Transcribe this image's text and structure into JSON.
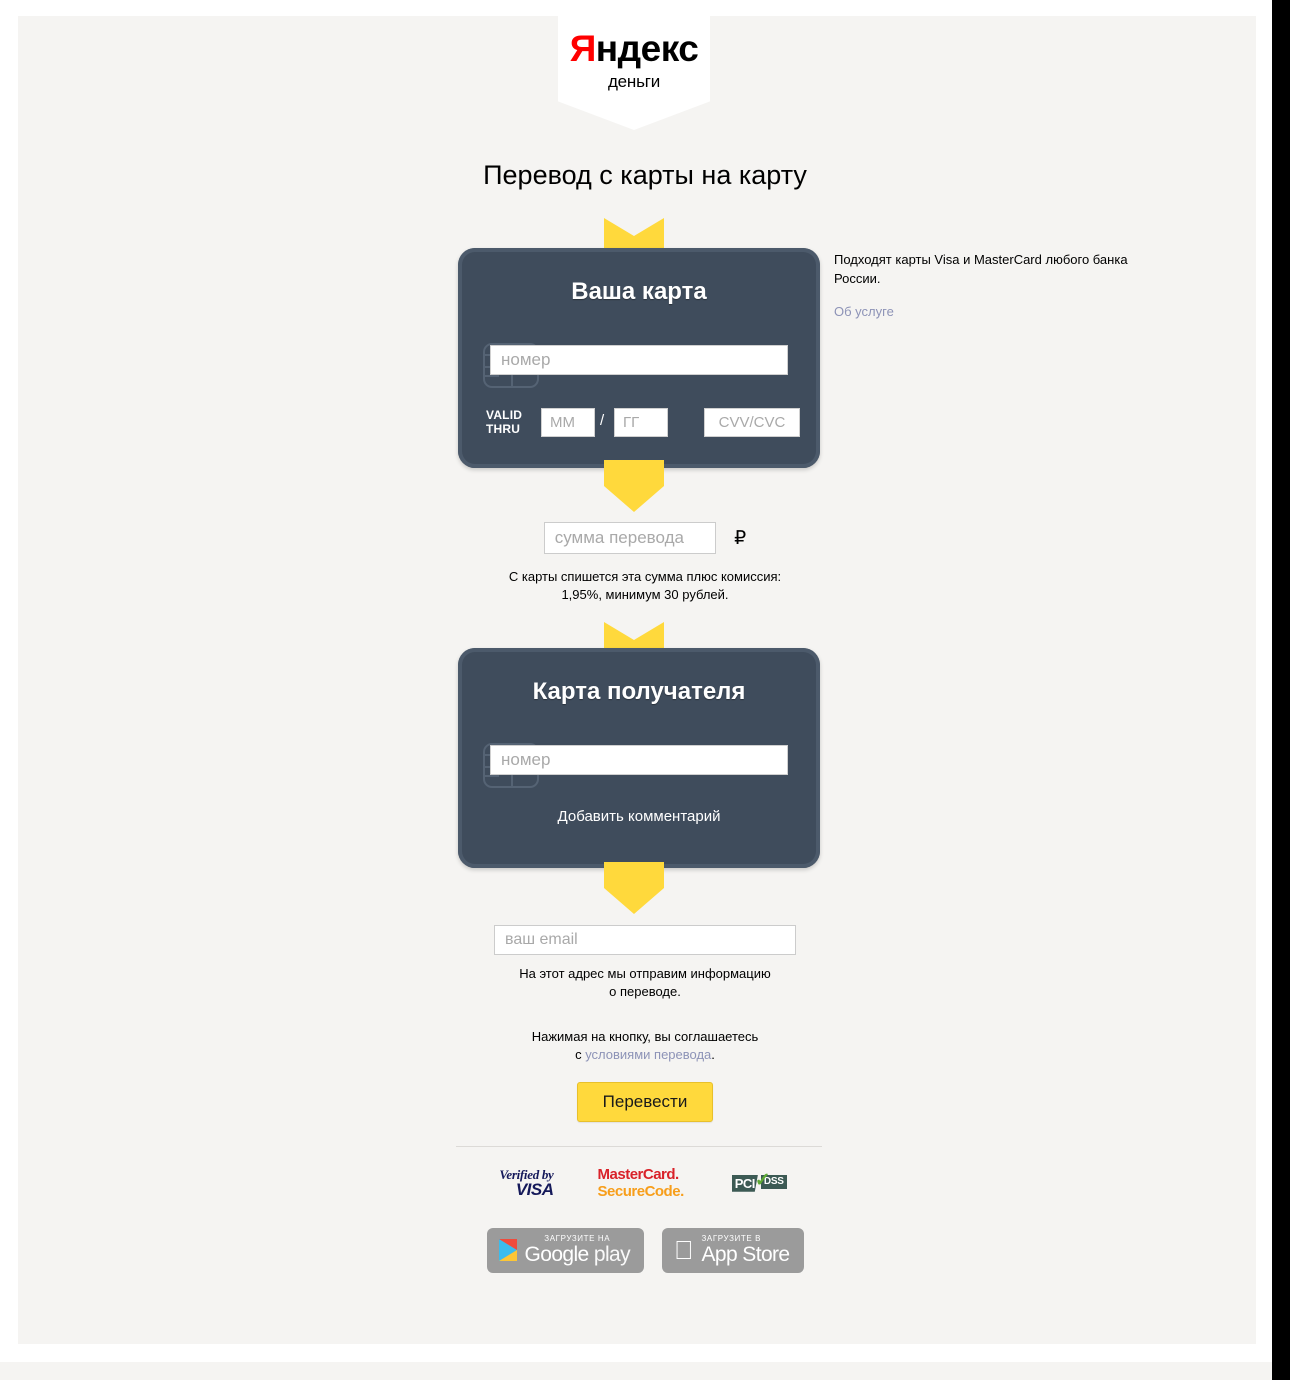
{
  "brand": {
    "logo_main_first": "Я",
    "logo_main_rest": "ндекс",
    "logo_sub": "деньги"
  },
  "page": {
    "title": "Перевод с карты на карту"
  },
  "sender_card": {
    "title": "Ваша карта",
    "number_placeholder": "номер",
    "valid_thru_line1": "VALID",
    "valid_thru_line2": "THRU",
    "month_placeholder": "ММ",
    "year_placeholder": "ГГ",
    "separator": "/",
    "cvv_placeholder": "CVV/CVC"
  },
  "side_note": {
    "text": "Подходят карты Visa и MasterCard любого банка России.",
    "link": "Об услуге"
  },
  "amount": {
    "placeholder": "сумма перевода",
    "currency": "₽",
    "fee_line1": "С карты спишется эта сумма плюс комиссия:",
    "fee_line2": "1,95%, минимум 30 рублей."
  },
  "recipient_card": {
    "title": "Карта получателя",
    "number_placeholder": "номер",
    "add_comment": "Добавить комментарий"
  },
  "email": {
    "placeholder": "ваш email",
    "note_line1": "На этот адрес мы отправим информацию",
    "note_line2": "о переводе."
  },
  "terms": {
    "line1": "Нажимая на кнопку, вы соглашаетесь",
    "prefix": "с ",
    "link": "условиями перевода",
    "suffix": "."
  },
  "submit": {
    "label": "Перевести"
  },
  "badges": {
    "visa_top": "Verified by",
    "visa_bottom": "VISA",
    "mastercard_top": "MasterCard.",
    "mastercard_bottom": "SecureCode.",
    "pci_left": "PCI",
    "pci_right": "DSS"
  },
  "stores": {
    "google_small": "Загрузите на",
    "google_big_1": "Google",
    "google_big_2": "play",
    "apple_small": "Загрузите в",
    "apple_big": "App Store"
  },
  "colors": {
    "page_background": "#f5f4f2",
    "card_background": "#3f4c5c",
    "accent_yellow": "#ffd93c",
    "link": "#8d93b7",
    "logo_red": "#ff0000"
  }
}
